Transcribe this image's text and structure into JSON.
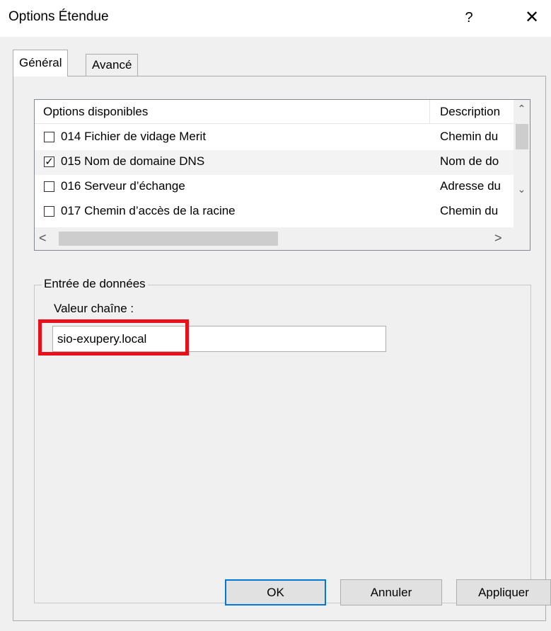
{
  "window": {
    "title": "Options Étendue",
    "help": "?",
    "close": "✕"
  },
  "tabs": [
    {
      "label": "Général",
      "active": true
    },
    {
      "label": "Avancé",
      "active": false
    }
  ],
  "options_list": {
    "columns": [
      "Options disponibles",
      "Description"
    ],
    "rows": [
      {
        "label": "014 Fichier de vidage Merit",
        "desc": "Chemin du",
        "checked": false
      },
      {
        "label": "015 Nom de domaine DNS",
        "desc": "Nom de do",
        "checked": true
      },
      {
        "label": "016 Serveur d’échange",
        "desc": "Adresse du",
        "checked": false
      },
      {
        "label": "017 Chemin d’accès de la racine",
        "desc": "Chemin du",
        "checked": false
      }
    ],
    "check_mark": "✓",
    "scroll_up": "⌃",
    "scroll_down": "⌄",
    "scroll_left": "<",
    "scroll_right": ">"
  },
  "data_entry": {
    "group_title": "Entrée de données",
    "field_label": "Valeur chaîne :",
    "field_value": "sio-exupery.local"
  },
  "buttons": {
    "ok": "OK",
    "cancel": "Annuler",
    "apply": "Appliquer"
  },
  "colors": {
    "highlight": "#e8101a",
    "default_button_border": "#0078d7"
  }
}
